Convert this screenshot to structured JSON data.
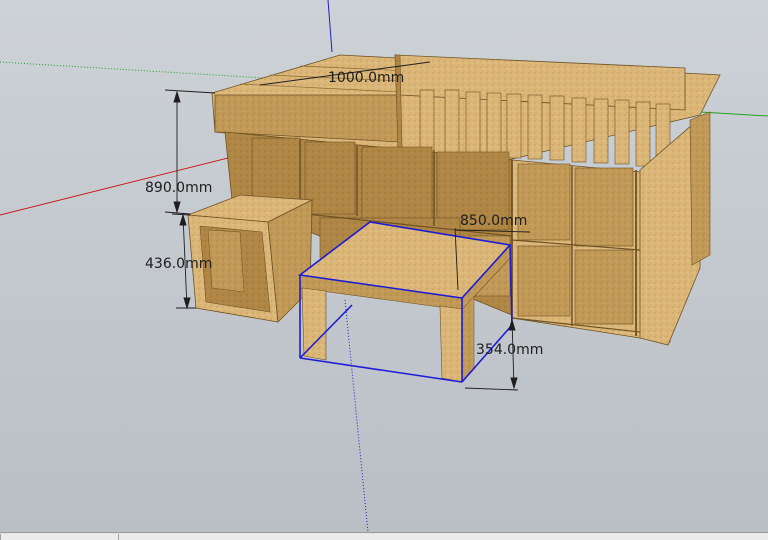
{
  "app": {
    "type": "3d-modeling-viewport"
  },
  "colors": {
    "sky": "#c9ced3",
    "ground": "#a9b0b6",
    "wood": "#dcb77a",
    "wood_dark": "#b9924f",
    "wood_shadow": "#9c7638",
    "selection": "#1c1cd6",
    "axis_red": "#c81e1e",
    "axis_green": "#1ea51e",
    "axis_blue": "#1e1ec8",
    "dimension": "#1e1e1e"
  },
  "dimensions": {
    "width_top": "1000.0mm",
    "height_total": "890.0mm",
    "height_cabinet": "436.0mm",
    "table_width": "850.0mm",
    "table_height": "354.0mm"
  },
  "model": {
    "selected_component": "coffee-table"
  }
}
